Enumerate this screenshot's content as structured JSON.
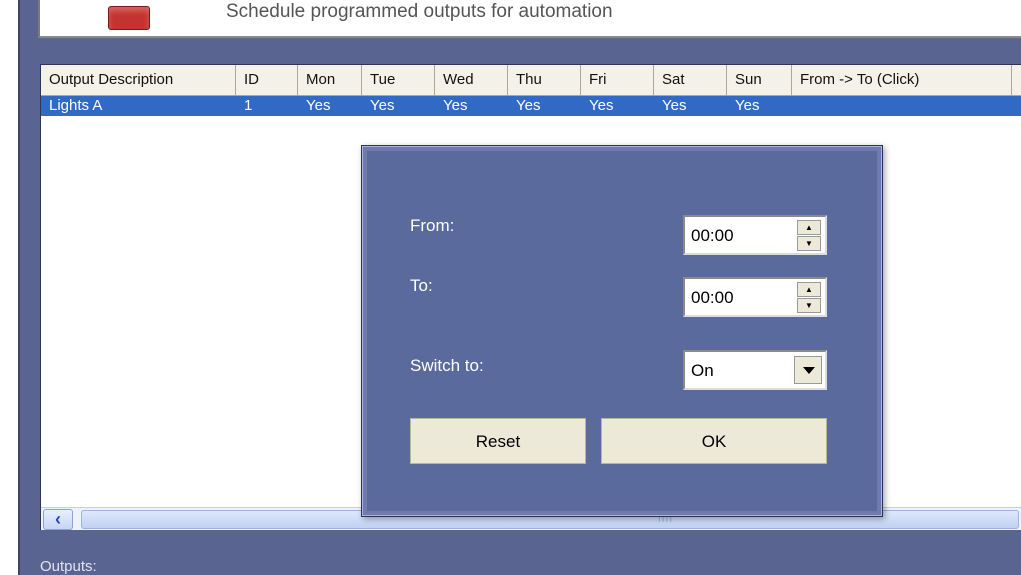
{
  "header": {
    "description": "Schedule programmed outputs for automation"
  },
  "table": {
    "columns": [
      "Output Description",
      "ID",
      "Mon",
      "Tue",
      "Wed",
      "Thu",
      "Fri",
      "Sat",
      "Sun",
      "From -> To (Click)"
    ],
    "rows": [
      {
        "description": "Lights A",
        "id": "1",
        "mon": "Yes",
        "tue": "Yes",
        "wed": "Yes",
        "thu": "Yes",
        "fri": "Yes",
        "sat": "Yes",
        "sun": "Yes",
        "from_to": ""
      }
    ]
  },
  "scrollbar": {
    "grip": "IIII"
  },
  "footer": {
    "outputs_label": "Outputs:"
  },
  "dialog": {
    "from_label": "From:",
    "from_value": "00:00",
    "to_label": "To:",
    "to_value": "00:00",
    "switch_label": "Switch to:",
    "switch_value": "On",
    "reset_label": "Reset",
    "ok_label": "OK"
  },
  "colors": {
    "selection": "#316ac5",
    "dialog_bg": "#5a6a9c",
    "frame_bg": "#5a6490",
    "header_icon": "#c4332f"
  }
}
